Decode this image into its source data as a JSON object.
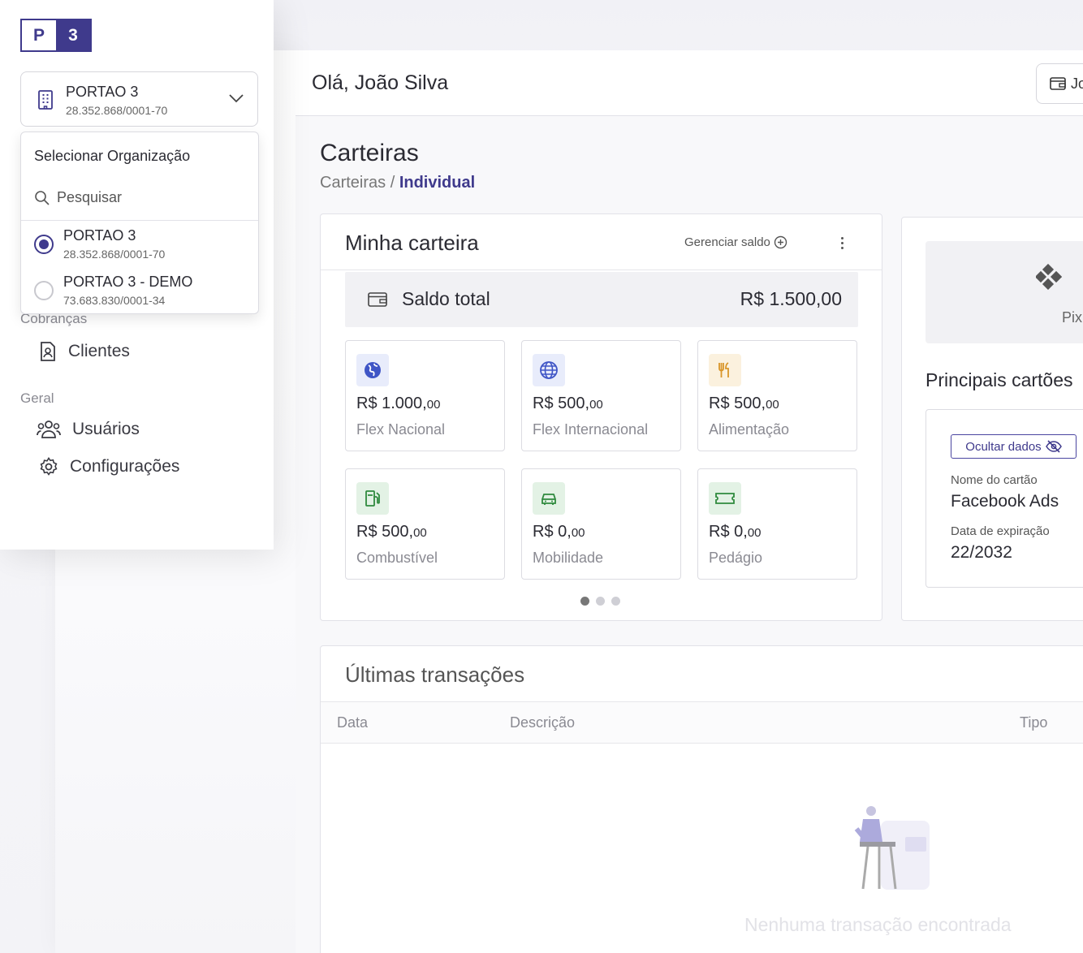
{
  "brand": {
    "letter": "P",
    "number": "3",
    "accent": "#3f3a8c"
  },
  "org_selector": {
    "name": "PORTAO 3",
    "cnpj": "28.352.868/0001-70"
  },
  "dropdown": {
    "title": "Selecionar Organização",
    "search_placeholder": "Pesquisar",
    "options": [
      {
        "name": "PORTAO 3",
        "cnpj": "28.352.868/0001-70",
        "selected": true
      },
      {
        "name": "PORTAO 3 - DEMO",
        "cnpj": "73.683.830/0001-34",
        "selected": false
      }
    ]
  },
  "sidebar": {
    "sections": [
      {
        "label": "Cobranças",
        "items": [
          {
            "label": "Clientes",
            "icon": "contact-file-icon"
          }
        ]
      },
      {
        "label": "Geral",
        "items": [
          {
            "label": "Usuários",
            "icon": "users-icon"
          },
          {
            "label": "Configurações",
            "icon": "gear-icon"
          }
        ]
      }
    ]
  },
  "header": {
    "greeting": "Olá,  João Silva",
    "button_label": "Jo"
  },
  "page": {
    "title": "Carteiras",
    "breadcrumb_root": "Carteiras",
    "breadcrumb_sep": " / ",
    "breadcrumb_current": "Individual"
  },
  "wallet": {
    "title": "Minha carteira",
    "manage_label": "Gerenciar saldo",
    "balance_label": "Saldo total",
    "balance_value": "R$ 1.500,00",
    "benefits": [
      {
        "value_main": "R$ 1.000,",
        "value_cents": "00",
        "label": "Flex Nacional",
        "icon": "globe-americas-icon",
        "color": "#3f55c6",
        "bg": "#e8ecfb"
      },
      {
        "value_main": "R$ 500,",
        "value_cents": "00",
        "label": "Flex Internacional",
        "icon": "globe-grid-icon",
        "color": "#3f55c6",
        "bg": "#e8ecfb"
      },
      {
        "value_main": "R$ 500,",
        "value_cents": "00",
        "label": "Alimentação",
        "icon": "fork-knife-icon",
        "color": "#d9962a",
        "bg": "#fbf1de"
      },
      {
        "value_main": "R$ 500,",
        "value_cents": "00",
        "label": "Combustível",
        "icon": "fuel-pump-icon",
        "color": "#2f8a3e",
        "bg": "#e3f2e5"
      },
      {
        "value_main": "R$ 0,",
        "value_cents": "00",
        "label": "Mobilidade",
        "icon": "car-icon",
        "color": "#2f8a3e",
        "bg": "#e3f2e5"
      },
      {
        "value_main": "R$ 0,",
        "value_cents": "00",
        "label": "Pedágio",
        "icon": "ticket-icon",
        "color": "#2f8a3e",
        "bg": "#e3f2e5"
      }
    ],
    "pages": 3,
    "active_page": 1
  },
  "right_panel": {
    "pix_label": "Pix",
    "top_cards_title": "Principais cartões",
    "hide_label": "Ocultar dados",
    "card_name_label": "Nome do cartão",
    "card_name": "Facebook Ads",
    "expiry_label": "Data de expiração",
    "expiry": "22/2032"
  },
  "transactions": {
    "title": "Últimas transações",
    "columns": {
      "date": "Data",
      "description": "Descrição",
      "type": "Tipo"
    },
    "empty_message": "Nenhuma transação encontrada"
  }
}
